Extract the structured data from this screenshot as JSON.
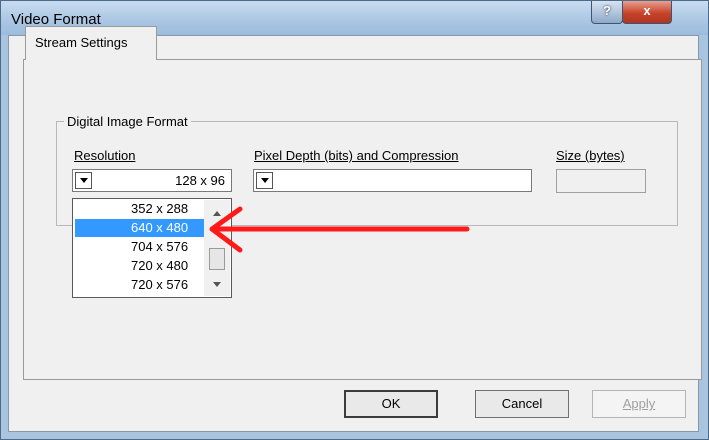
{
  "window": {
    "title": "Video Format",
    "help_label": "?",
    "close_label": "x"
  },
  "tabs": [
    {
      "label": "Stream Settings"
    }
  ],
  "group": {
    "title": "Digital Image Format",
    "resolution_label": "Resolution",
    "depth_label": "Pixel Depth (bits) and Compression",
    "size_label": "Size (bytes)",
    "resolution_value": "128 x 96",
    "depth_value": "",
    "size_value": ""
  },
  "resolution_options": [
    "352 x 288",
    "640 x 480",
    "704 x 576",
    "720 x 480",
    "720 x 576"
  ],
  "selected_option": "640 x 480",
  "buttons": {
    "ok": "OK",
    "cancel": "Cancel",
    "apply": "Apply"
  },
  "colors": {
    "selection": "#3399ff",
    "annotation_arrow": "#ff1a1a",
    "close_button": "#c7432b"
  }
}
